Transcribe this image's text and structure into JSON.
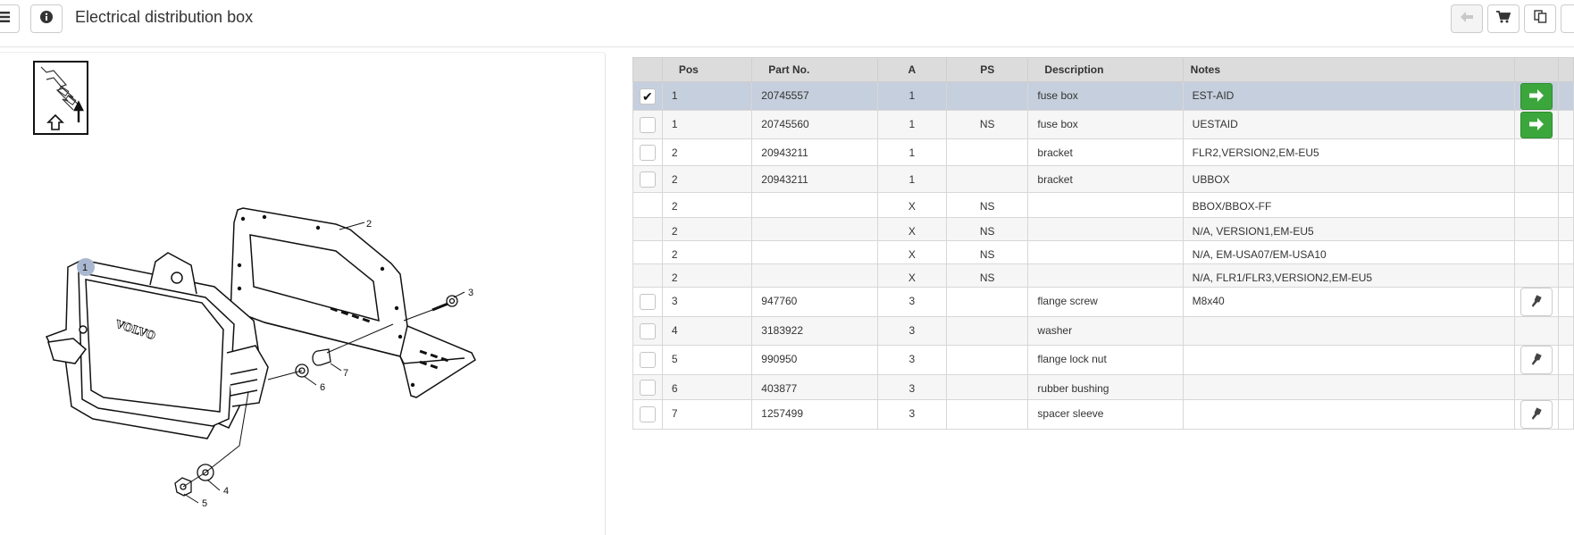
{
  "header": {
    "title": "Electrical distribution box",
    "icons": [
      "menu-icon",
      "info-icon",
      "arrow-left-icon",
      "cart-icon",
      "copy-icon"
    ]
  },
  "diagram": {
    "callouts": [
      "1",
      "2",
      "3",
      "4",
      "5",
      "6",
      "7"
    ],
    "logo_text": "VOLVO"
  },
  "table": {
    "headers": {
      "pos": "Pos",
      "part_no": "Part No.",
      "a": "A",
      "ps": "PS",
      "description": "Description",
      "notes": "Notes"
    },
    "rows": [
      {
        "pos": "1",
        "part_no": "20745557",
        "a": "1",
        "ps": "",
        "description": "fuse box",
        "notes": "EST-AID",
        "checked": true,
        "action": "go"
      },
      {
        "pos": "1",
        "part_no": "20745560",
        "a": "1",
        "ps": "NS",
        "description": "fuse box",
        "notes": "UESTAID",
        "checked": false,
        "action": "go"
      },
      {
        "pos": "2",
        "part_no": "20943211",
        "a": "1",
        "ps": "",
        "description": "bracket",
        "notes": "FLR2,VERSION2,EM-EU5",
        "checked": false,
        "action": ""
      },
      {
        "pos": "2",
        "part_no": "20943211",
        "a": "1",
        "ps": "",
        "description": "bracket",
        "notes": "UBBOX",
        "checked": false,
        "action": ""
      },
      {
        "pos": "2",
        "part_no": "",
        "a": "X",
        "ps": "NS",
        "description": "",
        "notes": "BBOX/BBOX-FF",
        "checked": null,
        "action": ""
      },
      {
        "pos": "2",
        "part_no": "",
        "a": "X",
        "ps": "NS",
        "description": "",
        "notes": "N/A, VERSION1,EM-EU5",
        "checked": null,
        "action": ""
      },
      {
        "pos": "2",
        "part_no": "",
        "a": "X",
        "ps": "NS",
        "description": "",
        "notes": "N/A, EM-USA07/EM-USA10",
        "checked": null,
        "action": ""
      },
      {
        "pos": "2",
        "part_no": "",
        "a": "X",
        "ps": "NS",
        "description": "",
        "notes": "N/A, FLR1/FLR3,VERSION2,EM-EU5",
        "checked": null,
        "action": ""
      },
      {
        "pos": "3",
        "part_no": "947760",
        "a": "3",
        "ps": "",
        "description": "flange screw",
        "notes": "M8x40",
        "checked": false,
        "action": "tool"
      },
      {
        "pos": "4",
        "part_no": "3183922",
        "a": "3",
        "ps": "",
        "description": "washer",
        "notes": "",
        "checked": false,
        "action": ""
      },
      {
        "pos": "5",
        "part_no": "990950",
        "a": "3",
        "ps": "",
        "description": "flange lock nut",
        "notes": "",
        "checked": false,
        "action": "tool"
      },
      {
        "pos": "6",
        "part_no": "403877",
        "a": "3",
        "ps": "",
        "description": "rubber bushing",
        "notes": "",
        "checked": false,
        "action": ""
      },
      {
        "pos": "7",
        "part_no": "1257499",
        "a": "3",
        "ps": "",
        "description": "spacer sleeve",
        "notes": "",
        "checked": false,
        "action": "tool"
      }
    ]
  }
}
